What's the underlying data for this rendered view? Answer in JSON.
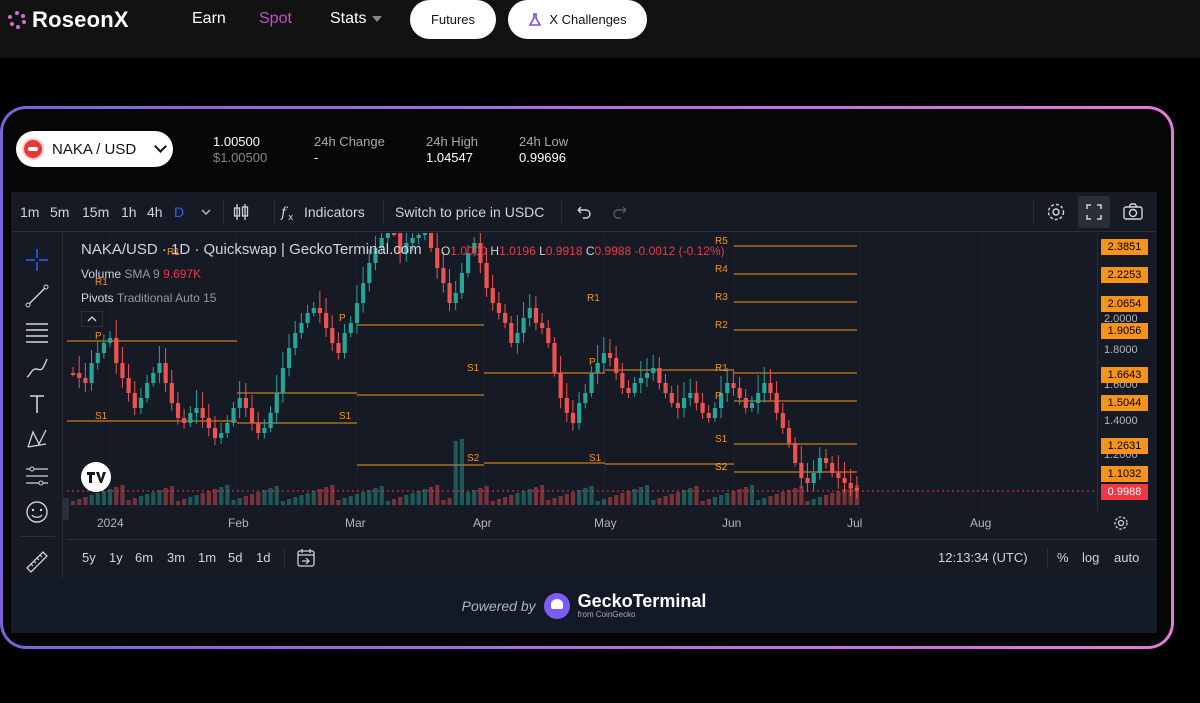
{
  "nav": {
    "logo": "RoseonX",
    "earn": "Earn",
    "spot": "Spot",
    "stats": "Stats",
    "futures": "Futures",
    "challenges": "X Challenges"
  },
  "market": {
    "pair": "NAKA / USD",
    "price": "1.00500",
    "price_usd": "$1.00500",
    "change_label": "24h Change",
    "change_value": "-",
    "high_label": "24h High",
    "high_value": "1.04547",
    "low_label": "24h Low",
    "low_value": "0.99696"
  },
  "toolbar": {
    "intervals": [
      "1m",
      "5m",
      "15m",
      "1h",
      "4h",
      "D"
    ],
    "selected_interval": "D",
    "indicators": "Indicators",
    "switch_price": "Switch to price in USDC"
  },
  "legend": {
    "title": "NAKA/USD · 1D · Quickswap | GeckoTerminal.com",
    "o_label": "O",
    "o": "1.0000",
    "h_label": "H",
    "h": "1.0196",
    "l_label": "L",
    "l": "0.9918",
    "c_label": "C",
    "c": "0.9988",
    "chg": "-0.0012 (-0.12%)",
    "volume_label": "Volume",
    "volume_sma": "SMA 9",
    "volume_value": "9.697K",
    "pivots_label": "Pivots",
    "pivots_params": "Traditional Auto 15"
  },
  "price_axis": {
    "tags": [
      "2.3851",
      "2.2253",
      "2.0654",
      "1.9056",
      "1.6643",
      "1.5044",
      "1.2631",
      "1.1032"
    ],
    "last_price": "0.9988",
    "ticks": [
      "2.0000",
      "1.8000",
      "1.6000",
      "1.4000",
      "1.2000"
    ]
  },
  "pivot_labels": [
    "R1",
    "P",
    "S1",
    "S1",
    "P",
    "R1",
    "S1",
    "S2",
    "P",
    "S1",
    "R5",
    "R4",
    "R3",
    "R2",
    "R1",
    "P",
    "S1",
    "S2",
    "R1",
    "S2"
  ],
  "time_axis": [
    "2024",
    "Feb",
    "Mar",
    "Apr",
    "May",
    "Jun",
    "Jul",
    "Aug"
  ],
  "bottom": {
    "ranges": [
      "5y",
      "1y",
      "6m",
      "3m",
      "1m",
      "5d",
      "1d"
    ],
    "clock": "12:13:34 (UTC)",
    "percent": "%",
    "log": "log",
    "auto": "auto"
  },
  "powered": {
    "text": "Powered by",
    "brand": "GeckoTerminal",
    "sub": "from CoinGecko"
  },
  "colors": {
    "accent_pink": "#c74ecb",
    "up": "#26a69a",
    "down": "#ef5350",
    "pivot": "#f7931a",
    "toolbar_sel": "#2962ff"
  }
}
